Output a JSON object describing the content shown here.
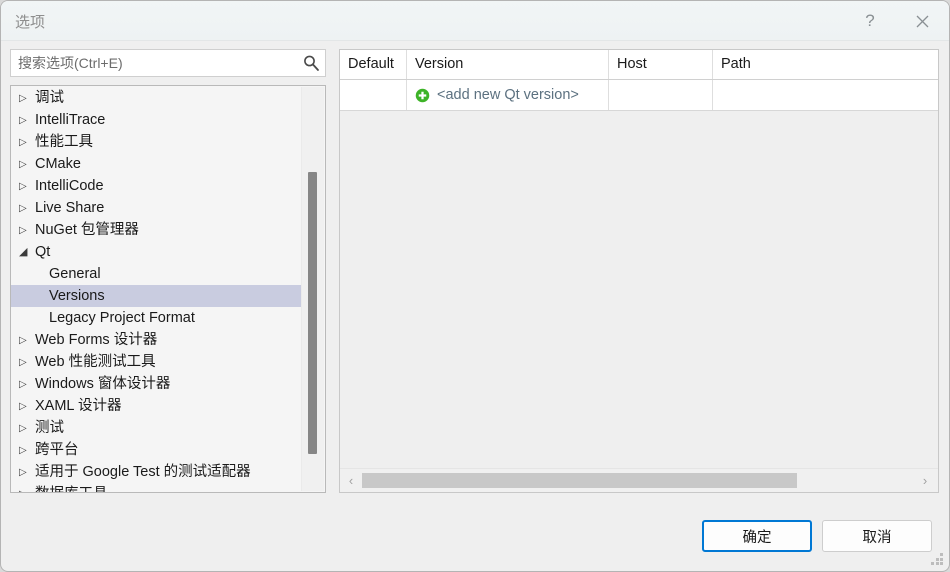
{
  "window": {
    "title": "选项",
    "help_label": "?",
    "close_icon": "close-icon"
  },
  "search": {
    "placeholder": "搜索选项(Ctrl+E)",
    "value": "",
    "icon": "search-icon"
  },
  "tree": {
    "items": [
      {
        "label": "调试",
        "level": 0,
        "state": "collapsed",
        "selected": false
      },
      {
        "label": "IntelliTrace",
        "level": 0,
        "state": "collapsed",
        "selected": false
      },
      {
        "label": "性能工具",
        "level": 0,
        "state": "collapsed",
        "selected": false
      },
      {
        "label": "CMake",
        "level": 0,
        "state": "collapsed",
        "selected": false
      },
      {
        "label": "IntelliCode",
        "level": 0,
        "state": "collapsed",
        "selected": false
      },
      {
        "label": "Live Share",
        "level": 0,
        "state": "collapsed",
        "selected": false
      },
      {
        "label": "NuGet 包管理器",
        "level": 0,
        "state": "collapsed",
        "selected": false
      },
      {
        "label": "Qt",
        "level": 0,
        "state": "expanded",
        "selected": false
      },
      {
        "label": "General",
        "level": 1,
        "state": "leaf",
        "selected": false
      },
      {
        "label": "Versions",
        "level": 1,
        "state": "leaf",
        "selected": true
      },
      {
        "label": "Legacy Project Format",
        "level": 1,
        "state": "leaf",
        "selected": false
      },
      {
        "label": "Web Forms 设计器",
        "level": 0,
        "state": "collapsed",
        "selected": false
      },
      {
        "label": "Web 性能测试工具",
        "level": 0,
        "state": "collapsed",
        "selected": false
      },
      {
        "label": "Windows 窗体设计器",
        "level": 0,
        "state": "collapsed",
        "selected": false
      },
      {
        "label": "XAML 设计器",
        "level": 0,
        "state": "collapsed",
        "selected": false
      },
      {
        "label": "测试",
        "level": 0,
        "state": "collapsed",
        "selected": false
      },
      {
        "label": "跨平台",
        "level": 0,
        "state": "collapsed",
        "selected": false
      },
      {
        "label": "适用于 Google Test 的测试适配器",
        "level": 0,
        "state": "collapsed",
        "selected": false
      },
      {
        "label": "数据库工具",
        "level": 0,
        "state": "collapsed",
        "selected": false
      }
    ]
  },
  "table": {
    "columns": [
      "Default",
      "Version",
      "Host",
      "Path"
    ],
    "rows": [
      {
        "default": "",
        "version": "<add new Qt version>",
        "host": "",
        "path": "",
        "icon": "add-icon"
      }
    ]
  },
  "scrollbars": {
    "left_arrow": "‹",
    "right_arrow": "›"
  },
  "footer": {
    "ok_label": "确定",
    "cancel_label": "取消"
  },
  "colors": {
    "accent": "#0078d4",
    "selection": "#c9cce0",
    "add_green": "#3db327",
    "link": "#5c7180"
  }
}
